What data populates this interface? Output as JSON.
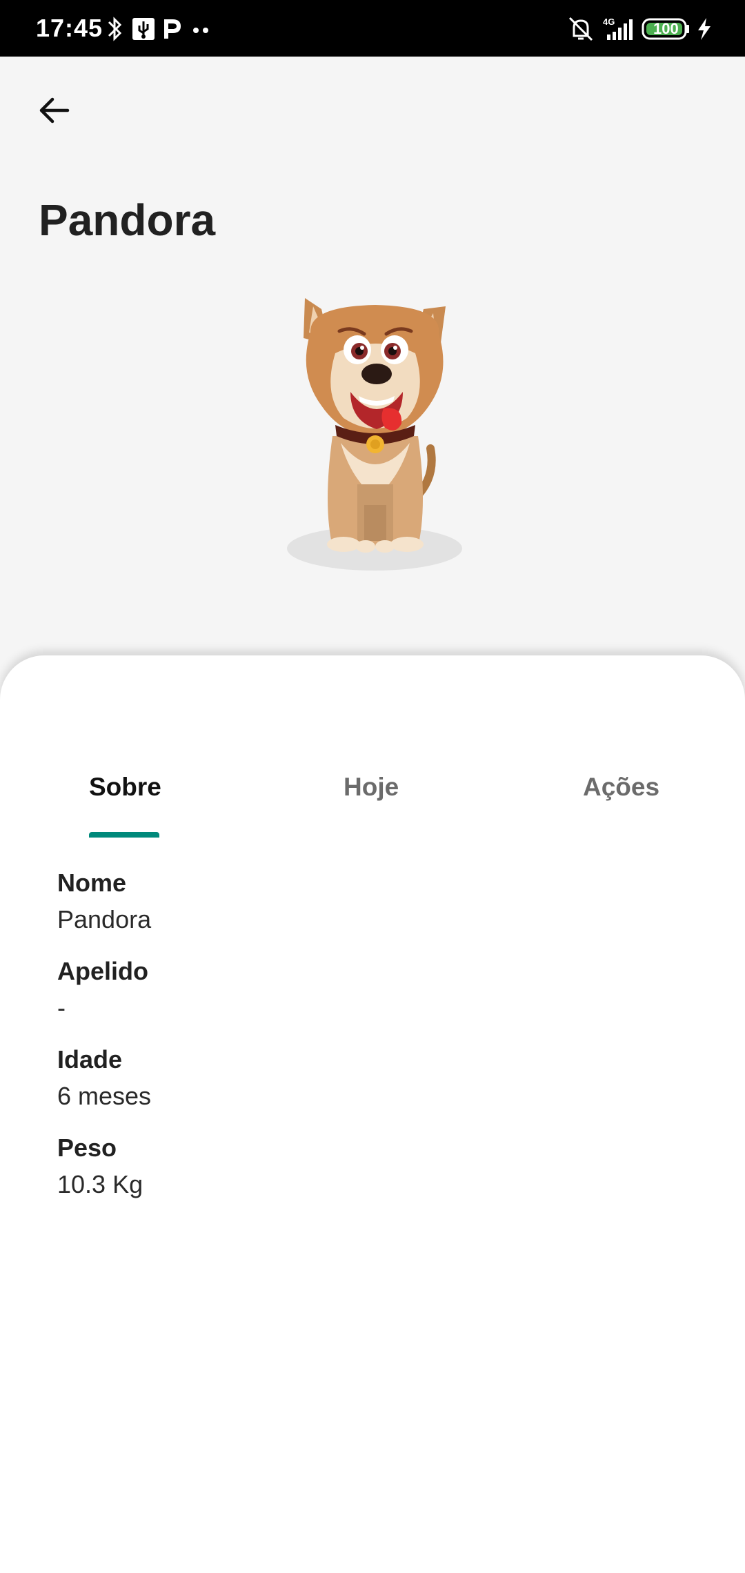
{
  "status_bar": {
    "time": "17:45",
    "network": "4G",
    "battery": "100"
  },
  "header": {
    "title": "Pandora"
  },
  "tabs": [
    {
      "label": "Sobre"
    },
    {
      "label": "Hoje"
    },
    {
      "label": "Ações"
    }
  ],
  "about": [
    {
      "label": "Nome",
      "value": "Pandora"
    },
    {
      "label": "Apelido",
      "value": "-"
    },
    {
      "label": "Idade",
      "value": "6 meses"
    },
    {
      "label": "Peso",
      "value": "10.3 Kg"
    }
  ],
  "colors": {
    "accent": "#00897b",
    "status_bar": "#000000",
    "battery": "#4caf50"
  }
}
